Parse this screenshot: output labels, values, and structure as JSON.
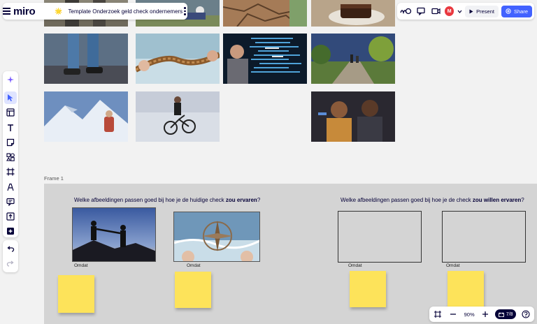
{
  "app": {
    "logo": "miro"
  },
  "board": {
    "emoji": "🌟",
    "title": "Template Onderzoek geld check ondernemers"
  },
  "header": {
    "present_label": "Present",
    "share_label": "Share",
    "avatar_initial": "M"
  },
  "frame": {
    "label": "Frame 1",
    "question_left": {
      "prefix": "Welke afbeeldingen passen goed bij hoe je de huidige check ",
      "bold": "zou ervaren",
      "suffix": "?"
    },
    "question_right": {
      "prefix": "Welke afbeeldingen passen goed bij hoe je de check ",
      "bold": "zou willen ervaren",
      "suffix": "?"
    },
    "omdat": [
      "Omdat",
      "Omdat",
      "Omdat",
      "Omdat"
    ]
  },
  "zoom": {
    "value": "90%",
    "pages": "7/8"
  },
  "colors": {
    "accent": "#4262ff",
    "sticky": "#fde35a",
    "frame_bg": "#d4d4d4",
    "avatar": "#e9383f"
  }
}
